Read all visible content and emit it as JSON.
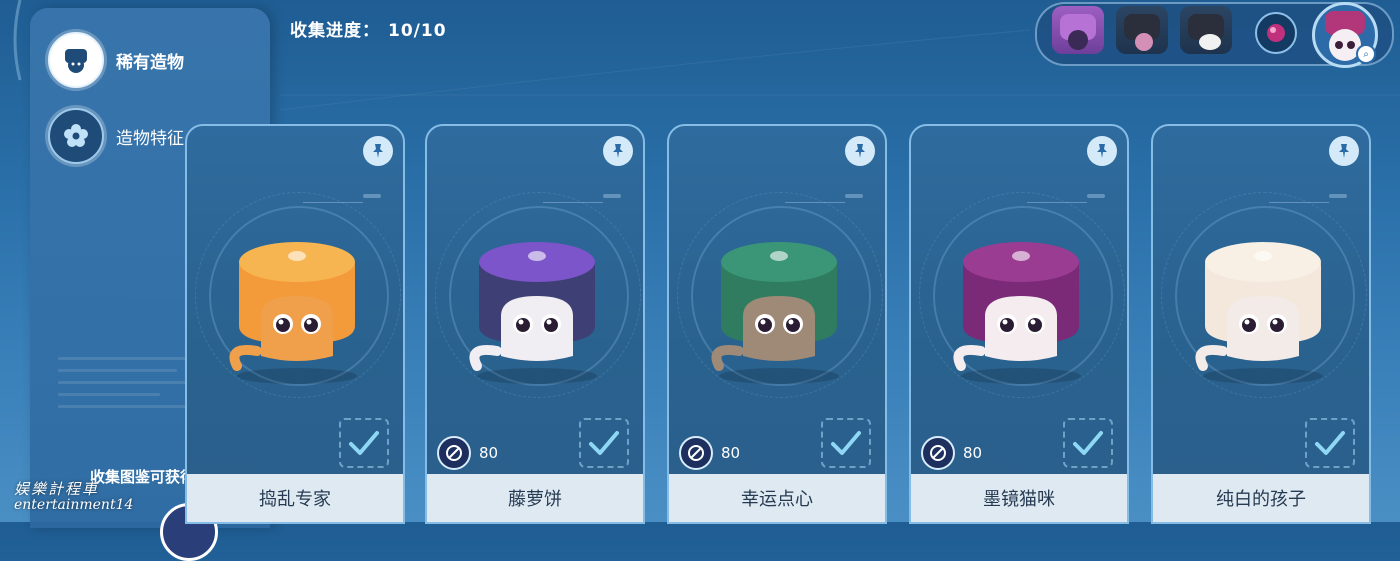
{
  "progress": {
    "label": "收集进度：",
    "value": "10/10"
  },
  "sidebar": {
    "items": [
      {
        "label": "稀有造物",
        "icon": "hat-avatar-icon",
        "active": true
      },
      {
        "label": "造物特征",
        "icon": "flower-badge-icon",
        "active": false
      }
    ],
    "reward_label": "收集图鉴可获得"
  },
  "cards": [
    {
      "name": "捣乱专家",
      "cost": "",
      "hat_color": "#f39a3a",
      "hat_top": "#f7b551",
      "cat_fur": "#f0a04a",
      "pinned": true,
      "collected": true
    },
    {
      "name": "藤萝饼",
      "cost": "80",
      "hat_color": "#3d3f75",
      "hat_top": "#7b55c9",
      "cat_fur": "#f1eef3",
      "pinned": true,
      "collected": true
    },
    {
      "name": "幸运点心",
      "cost": "80",
      "hat_color": "#2f7c60",
      "hat_top": "#3b9577",
      "cat_fur": "#9e8a76",
      "pinned": true,
      "collected": true
    },
    {
      "name": "墨镜猫咪",
      "cost": "80",
      "hat_color": "#7b2a78",
      "hat_top": "#9b3c93",
      "cat_fur": "#f4ecef",
      "pinned": true,
      "collected": true
    },
    {
      "name": "纯白的孩子",
      "cost": "",
      "hat_color": "#f4e8dc",
      "hat_top": "#f8efe5",
      "cat_fur": "#f3ebe7",
      "pinned": true,
      "collected": true
    }
  ],
  "top_selector": {
    "thumbs": [
      "purple-hat-thumb",
      "dark-hat-thumb",
      "white-hat-thumb"
    ]
  },
  "watermark": {
    "line1": "娱樂計程車",
    "line2": "entertainment14"
  }
}
